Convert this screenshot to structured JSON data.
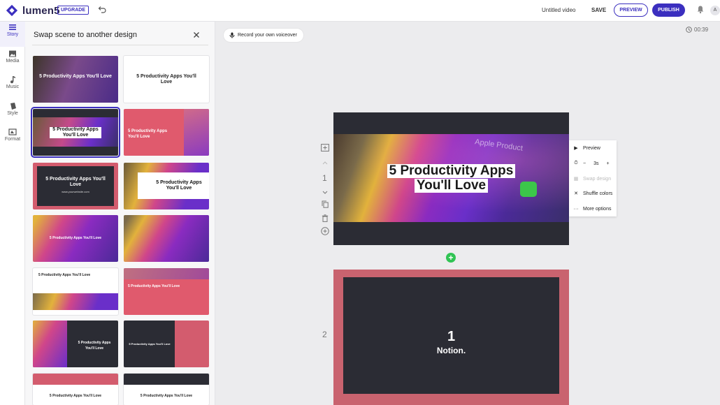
{
  "app": {
    "name": "lumen5",
    "upgrade_label": "UPGRADE"
  },
  "header": {
    "video_title": "Untitled video",
    "save_label": "SAVE",
    "preview_label": "PREVIEW",
    "publish_label": "PUBLISH",
    "avatar_initial": "A"
  },
  "rail": {
    "items": [
      {
        "label": "Story",
        "icon": "story-icon",
        "active": true
      },
      {
        "label": "Media",
        "icon": "media-icon"
      },
      {
        "label": "Music",
        "icon": "music-icon"
      },
      {
        "label": "Style",
        "icon": "style-icon"
      },
      {
        "label": "Format",
        "icon": "format-icon"
      }
    ]
  },
  "panel": {
    "title": "Swap scene to another design",
    "designs": [
      {
        "text": "5 Productivity Apps You'll Love"
      },
      {
        "text": "5 Productivity Apps You'll Love"
      },
      {
        "text": "5 Productivity Apps You'll Love",
        "selected": true
      },
      {
        "text": "5 Productivity Apps You'll Love"
      },
      {
        "text": "5 Productivity Apps You'll Love",
        "sub": "www.yourwebsite.com"
      },
      {
        "text": "5 Productivity Apps You'll Love"
      },
      {
        "text": "5 Productivity Apps You'll Love"
      },
      {
        "text": ""
      },
      {
        "text": "5 Productivity Apps You'll Love"
      },
      {
        "text": "5 Productivity Apps You'll Love"
      },
      {
        "text": "5 Productivity Apps You'll Love"
      },
      {
        "text": "5 Productivity Apps You'll Love"
      },
      {
        "text": "5 Productivity Apps You'll Love"
      },
      {
        "text": "5 Productivity Apps You'll Love"
      }
    ]
  },
  "canvas": {
    "voiceover_label": "Record your own voiceover",
    "duration": "00:39",
    "scenes": [
      {
        "number": "1",
        "headline_line1": "5 Productivity Apps",
        "headline_line2": "You'll Love",
        "photo_caption": "Apple Product"
      },
      {
        "number": "2",
        "big_text": "1",
        "small_text": "Notion."
      }
    ],
    "scene_menu": {
      "preview": "Preview",
      "duration": "3s",
      "minus": "−",
      "plus": "+",
      "swap_design": "Swap design",
      "shuffle_colors": "Shuffle colors",
      "more_options": "More options"
    }
  },
  "colors": {
    "brand": "#3b2fbf",
    "add_scene": "#31c454",
    "scene2_frame": "#c9636f"
  }
}
